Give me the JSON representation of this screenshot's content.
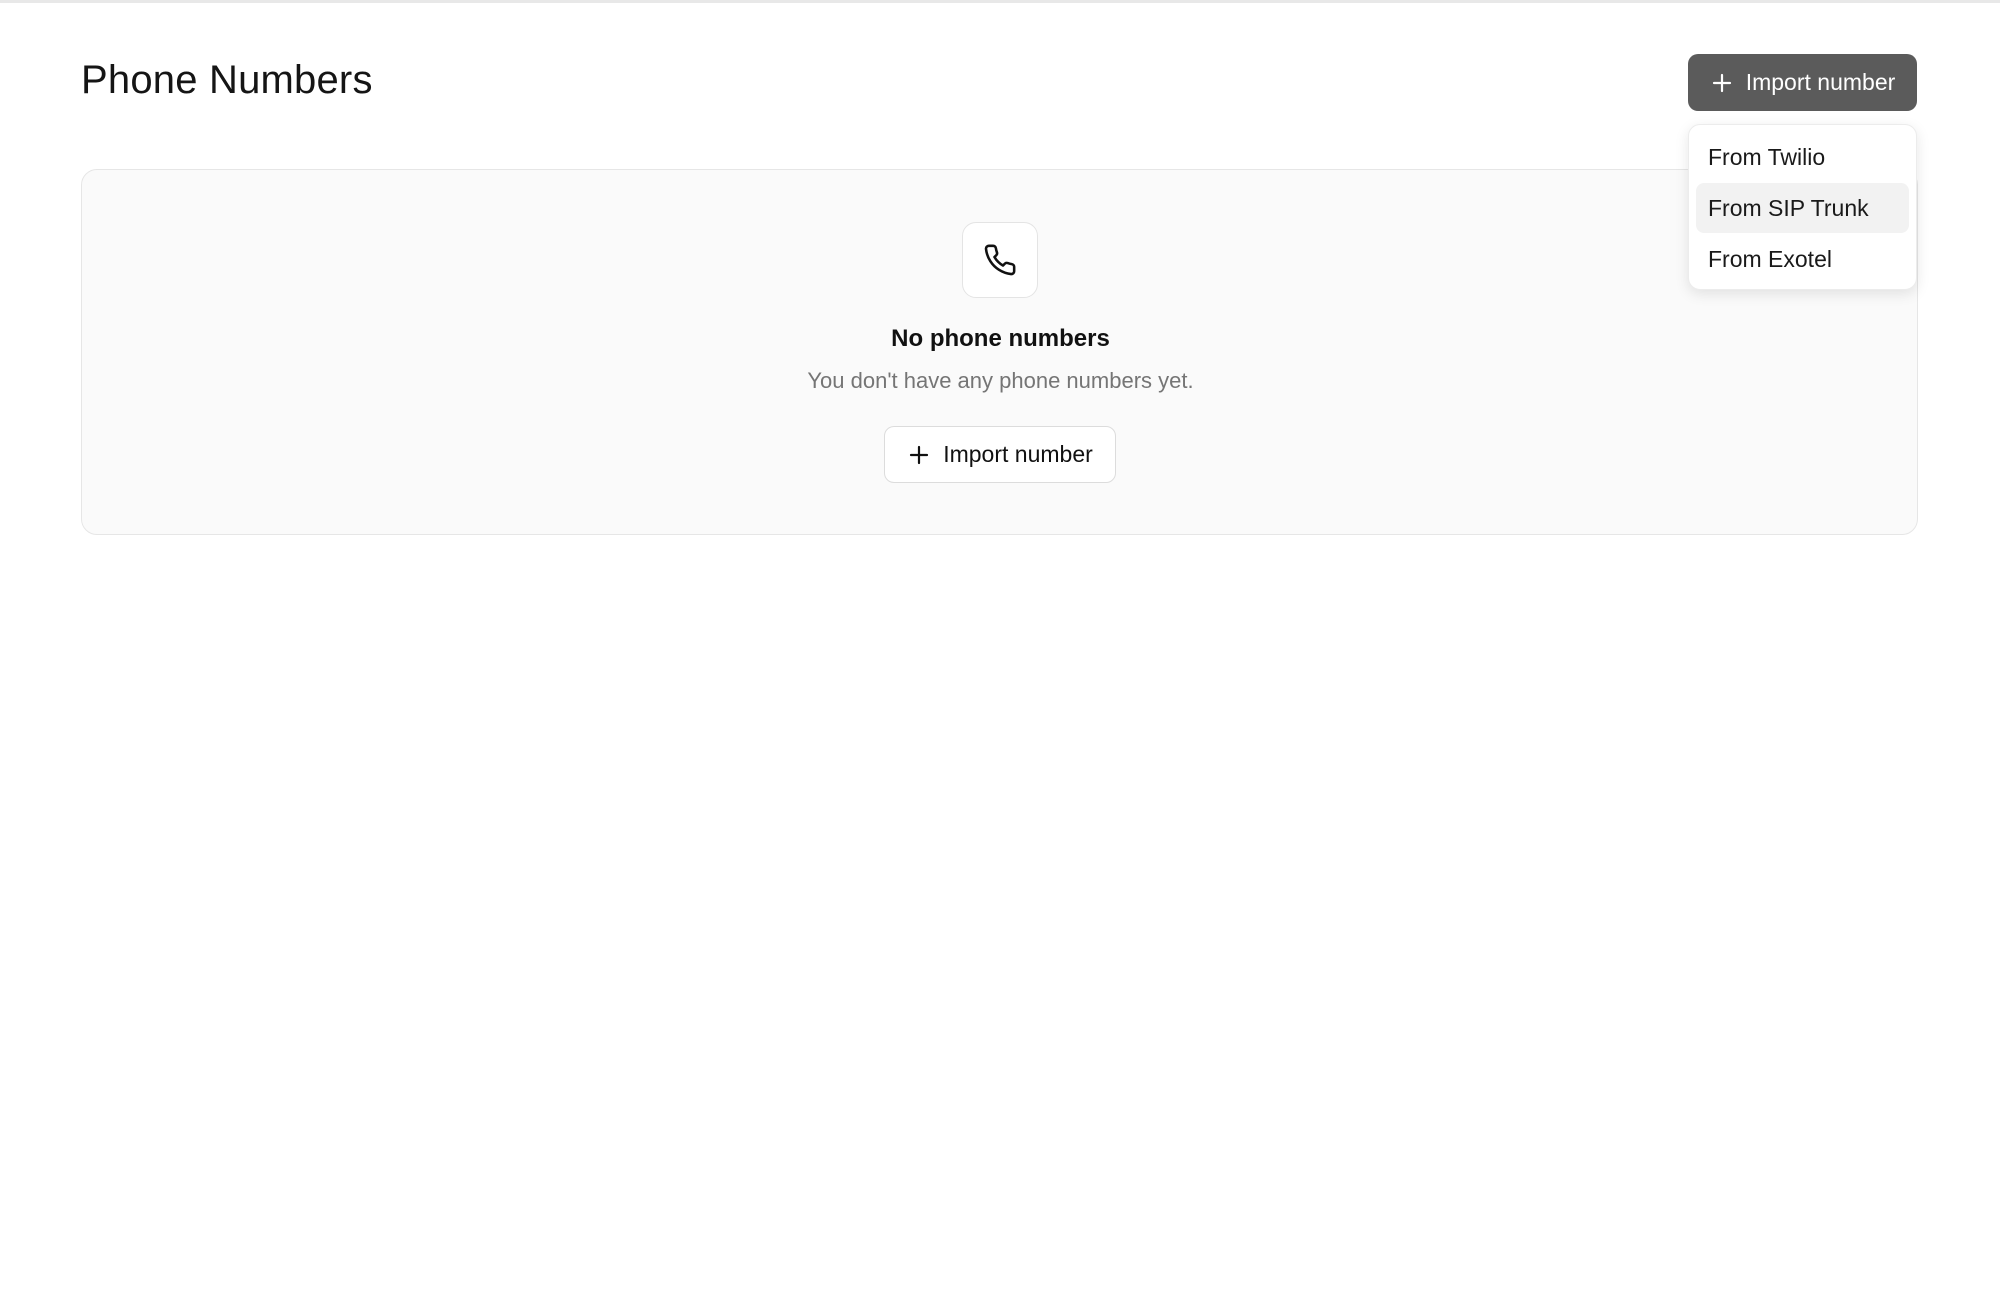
{
  "page": {
    "title": "Phone Numbers"
  },
  "header": {
    "import_button_label": "Import number",
    "import_button_icon": "plus-icon"
  },
  "import_menu": {
    "items": [
      {
        "label": "From Twilio",
        "highlighted": false
      },
      {
        "label": "From SIP Trunk",
        "highlighted": true
      },
      {
        "label": "From Exotel",
        "highlighted": false
      }
    ]
  },
  "empty_state": {
    "icon": "phone-icon",
    "title": "No phone numbers",
    "subtitle": "You don't have any phone numbers yet.",
    "button_label": "Import number",
    "button_icon": "plus-icon"
  },
  "colors": {
    "primary_button_bg": "#5b5b5b",
    "card_bg": "#fafafa",
    "menu_highlight": "#f2f2f2",
    "muted_text": "#757575"
  }
}
